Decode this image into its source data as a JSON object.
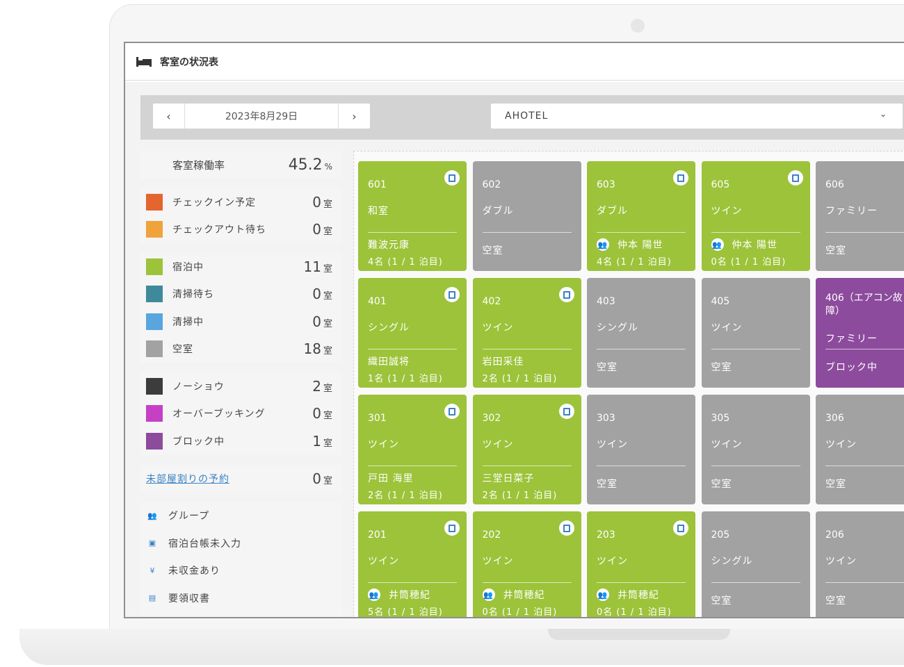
{
  "header": {
    "title": "客室の状況表"
  },
  "toolbar": {
    "prev": "‹",
    "date": "2023年8月29日",
    "next": "›",
    "hotel": "AHOTEL",
    "hotel_chevron": "⌄"
  },
  "summary": {
    "occupancy_label": "客室稼働率",
    "occupancy_value": "45.2",
    "occupancy_unit": "%",
    "unit_room": "室",
    "groups": [
      [
        {
          "label": "チェックイン予定",
          "count": "0",
          "color": "#e5652e"
        },
        {
          "label": "チェックアウト待ち",
          "count": "0",
          "color": "#f0a33b"
        }
      ],
      [
        {
          "label": "宿泊中",
          "count": "11",
          "color": "#9cc33a"
        },
        {
          "label": "清掃待ち",
          "count": "0",
          "color": "#3f8a9a"
        },
        {
          "label": "清掃中",
          "count": "0",
          "color": "#58a5df"
        },
        {
          "label": "空室",
          "count": "18",
          "color": "#a2a2a2"
        }
      ],
      [
        {
          "label": "ノーショウ",
          "count": "2",
          "color": "#3c3c3c"
        },
        {
          "label": "オーバーブッキング",
          "count": "0",
          "color": "#c640c6"
        },
        {
          "label": "ブロック中",
          "count": "1",
          "color": "#8c4b9c"
        }
      ]
    ],
    "unassigned_label": "未部屋割りの予約",
    "unassigned_count": "0"
  },
  "icon_legend": [
    {
      "icon": "group-icon",
      "glyph": "👥",
      "label": "グループ"
    },
    {
      "icon": "register-icon",
      "glyph": "▣",
      "label": "宿泊台帳未入力"
    },
    {
      "icon": "yen-icon",
      "glyph": "¥",
      "label": "未収金あり"
    },
    {
      "icon": "receipt-icon",
      "glyph": "▤",
      "label": "要領収書"
    }
  ],
  "colors": {
    "occupied": "#9cc33a",
    "vacant": "#a2a2a2",
    "blocked": "#8c4b9c",
    "link": "#3a82c4"
  },
  "rooms": [
    [
      {
        "number": "601",
        "type": "和室",
        "status": "green",
        "book": true,
        "guest": "難波元康",
        "group": false,
        "count": "4名 (1 / 1 泊目)"
      },
      {
        "number": "602",
        "type": "ダブル",
        "status": "gray",
        "book": false,
        "guest": "空室",
        "group": false,
        "count": ""
      },
      {
        "number": "603",
        "type": "ダブル",
        "status": "green",
        "book": true,
        "guest": "仲本 陽世",
        "group": true,
        "count": "4名 (1 / 1 泊目)"
      },
      {
        "number": "605",
        "type": "ツイン",
        "status": "green",
        "book": true,
        "guest": "仲本 陽世",
        "group": true,
        "count": "0名 (1 / 1 泊目)"
      },
      {
        "number": "606",
        "type": "ファミリー",
        "status": "gray",
        "book": false,
        "guest": "空室",
        "group": false,
        "count": ""
      }
    ],
    [
      {
        "number": "401",
        "type": "シングル",
        "status": "green",
        "book": true,
        "guest": "織田誠将",
        "group": false,
        "count": "1名 (1 / 1 泊目)"
      },
      {
        "number": "402",
        "type": "ツイン",
        "status": "green",
        "book": true,
        "guest": "岩田采佳",
        "group": false,
        "count": "2名 (1 / 1 泊目)"
      },
      {
        "number": "403",
        "type": "シングル",
        "status": "gray",
        "book": false,
        "guest": "空室",
        "group": false,
        "count": ""
      },
      {
        "number": "405",
        "type": "ツイン",
        "status": "gray",
        "book": false,
        "guest": "空室",
        "group": false,
        "count": ""
      },
      {
        "number": "406（エアコン故障）",
        "type": "ファミリー",
        "status": "purple",
        "book": false,
        "guest": "ブロック中",
        "group": false,
        "count": "",
        "long": true
      }
    ],
    [
      {
        "number": "301",
        "type": "ツイン",
        "status": "green",
        "book": true,
        "guest": "戸田 海里",
        "group": false,
        "count": "2名 (1 / 1 泊目)"
      },
      {
        "number": "302",
        "type": "ツイン",
        "status": "green",
        "book": true,
        "guest": "三堂日菜子",
        "group": false,
        "count": "2名 (1 / 1 泊目)"
      },
      {
        "number": "303",
        "type": "ツイン",
        "status": "gray",
        "book": false,
        "guest": "空室",
        "group": false,
        "count": ""
      },
      {
        "number": "305",
        "type": "ツイン",
        "status": "gray",
        "book": false,
        "guest": "空室",
        "group": false,
        "count": ""
      },
      {
        "number": "306",
        "type": "ツイン",
        "status": "gray",
        "book": false,
        "guest": "空室",
        "group": false,
        "count": ""
      }
    ],
    [
      {
        "number": "201",
        "type": "ツイン",
        "status": "green",
        "book": true,
        "guest": "井筒穂紀",
        "group": true,
        "count": "5名 (1 / 1 泊目)"
      },
      {
        "number": "202",
        "type": "ツイン",
        "status": "green",
        "book": true,
        "guest": "井筒穂紀",
        "group": true,
        "count": "0名 (1 / 1 泊目)"
      },
      {
        "number": "203",
        "type": "ツイン",
        "status": "green",
        "book": true,
        "guest": "井筒穂紀",
        "group": true,
        "count": "0名 (1 / 1 泊目)"
      },
      {
        "number": "205",
        "type": "シングル",
        "status": "gray",
        "book": false,
        "guest": "空室",
        "group": false,
        "count": ""
      },
      {
        "number": "206",
        "type": "ツイン",
        "status": "gray",
        "book": false,
        "guest": "空室",
        "group": false,
        "count": ""
      }
    ]
  ]
}
